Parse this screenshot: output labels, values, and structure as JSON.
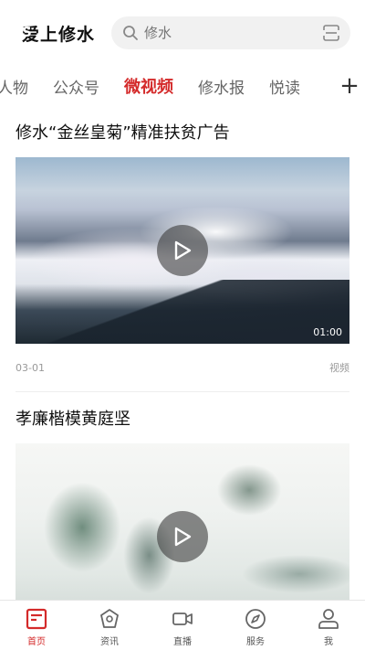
{
  "header": {
    "app_title": "爱上修水",
    "search_placeholder": "修水"
  },
  "tabs": [
    {
      "label": "人物",
      "active": false
    },
    {
      "label": "公众号",
      "active": false
    },
    {
      "label": "微视频",
      "active": true
    },
    {
      "label": "修水报",
      "active": false
    },
    {
      "label": "悦读",
      "active": false
    }
  ],
  "add_tab_symbol": "+",
  "feed": [
    {
      "title": "修水“金丝皇菊”精准扶贫广告",
      "duration": "01:00",
      "date": "03-01",
      "type": "视频"
    },
    {
      "title": "孝廉楷模黄庭坚",
      "duration": "",
      "date": "",
      "type": ""
    }
  ],
  "bottom_nav": [
    {
      "label": "首页",
      "icon": "home-icon",
      "active": true
    },
    {
      "label": "资讯",
      "icon": "news-icon",
      "active": false
    },
    {
      "label": "直播",
      "icon": "live-icon",
      "active": false
    },
    {
      "label": "服务",
      "icon": "compass-icon",
      "active": false
    },
    {
      "label": "我",
      "icon": "user-icon",
      "active": false
    }
  ],
  "colors": {
    "accent": "#d42a2a",
    "brand_blue": "#1e8ee8"
  }
}
